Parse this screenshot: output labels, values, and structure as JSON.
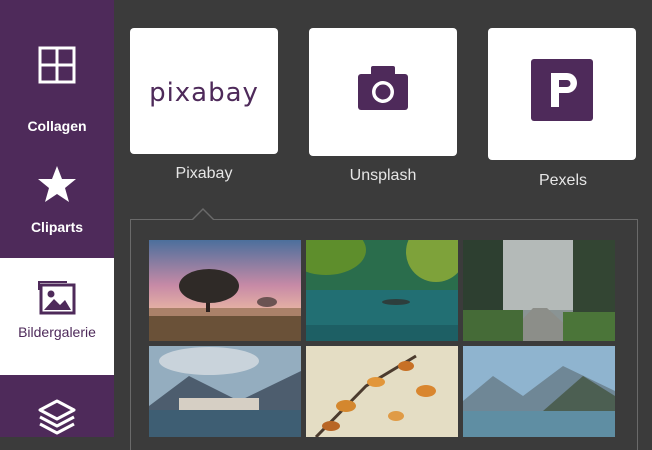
{
  "sidebar": {
    "items": [
      {
        "label": "Collagen",
        "icon": "collage-grid-icon"
      },
      {
        "label": "Cliparts",
        "icon": "star-icon"
      },
      {
        "label": "Bildergalerie",
        "icon": "image-gallery-icon",
        "active": true
      },
      {
        "label": "",
        "icon": "layers-icon"
      }
    ]
  },
  "providers": [
    {
      "label": "Pixabay",
      "logo_text": "pixabay"
    },
    {
      "label": "Unsplash",
      "icon": "camera-icon"
    },
    {
      "label": "Pexels",
      "icon": "pexels-p-icon"
    }
  ],
  "gallery": {
    "images": [
      {
        "subject": "lone tree at sunrise in misty field"
      },
      {
        "subject": "green lake with rowboat"
      },
      {
        "subject": "forest road in fog"
      },
      {
        "subject": "lakeside village and mountains"
      },
      {
        "subject": "autumn leaves branch"
      },
      {
        "subject": "mountain lake"
      }
    ]
  },
  "colors": {
    "brand": "#4e2a5a",
    "background": "#3b3b3b",
    "card": "#ffffff",
    "label": "#e6e6e6"
  }
}
